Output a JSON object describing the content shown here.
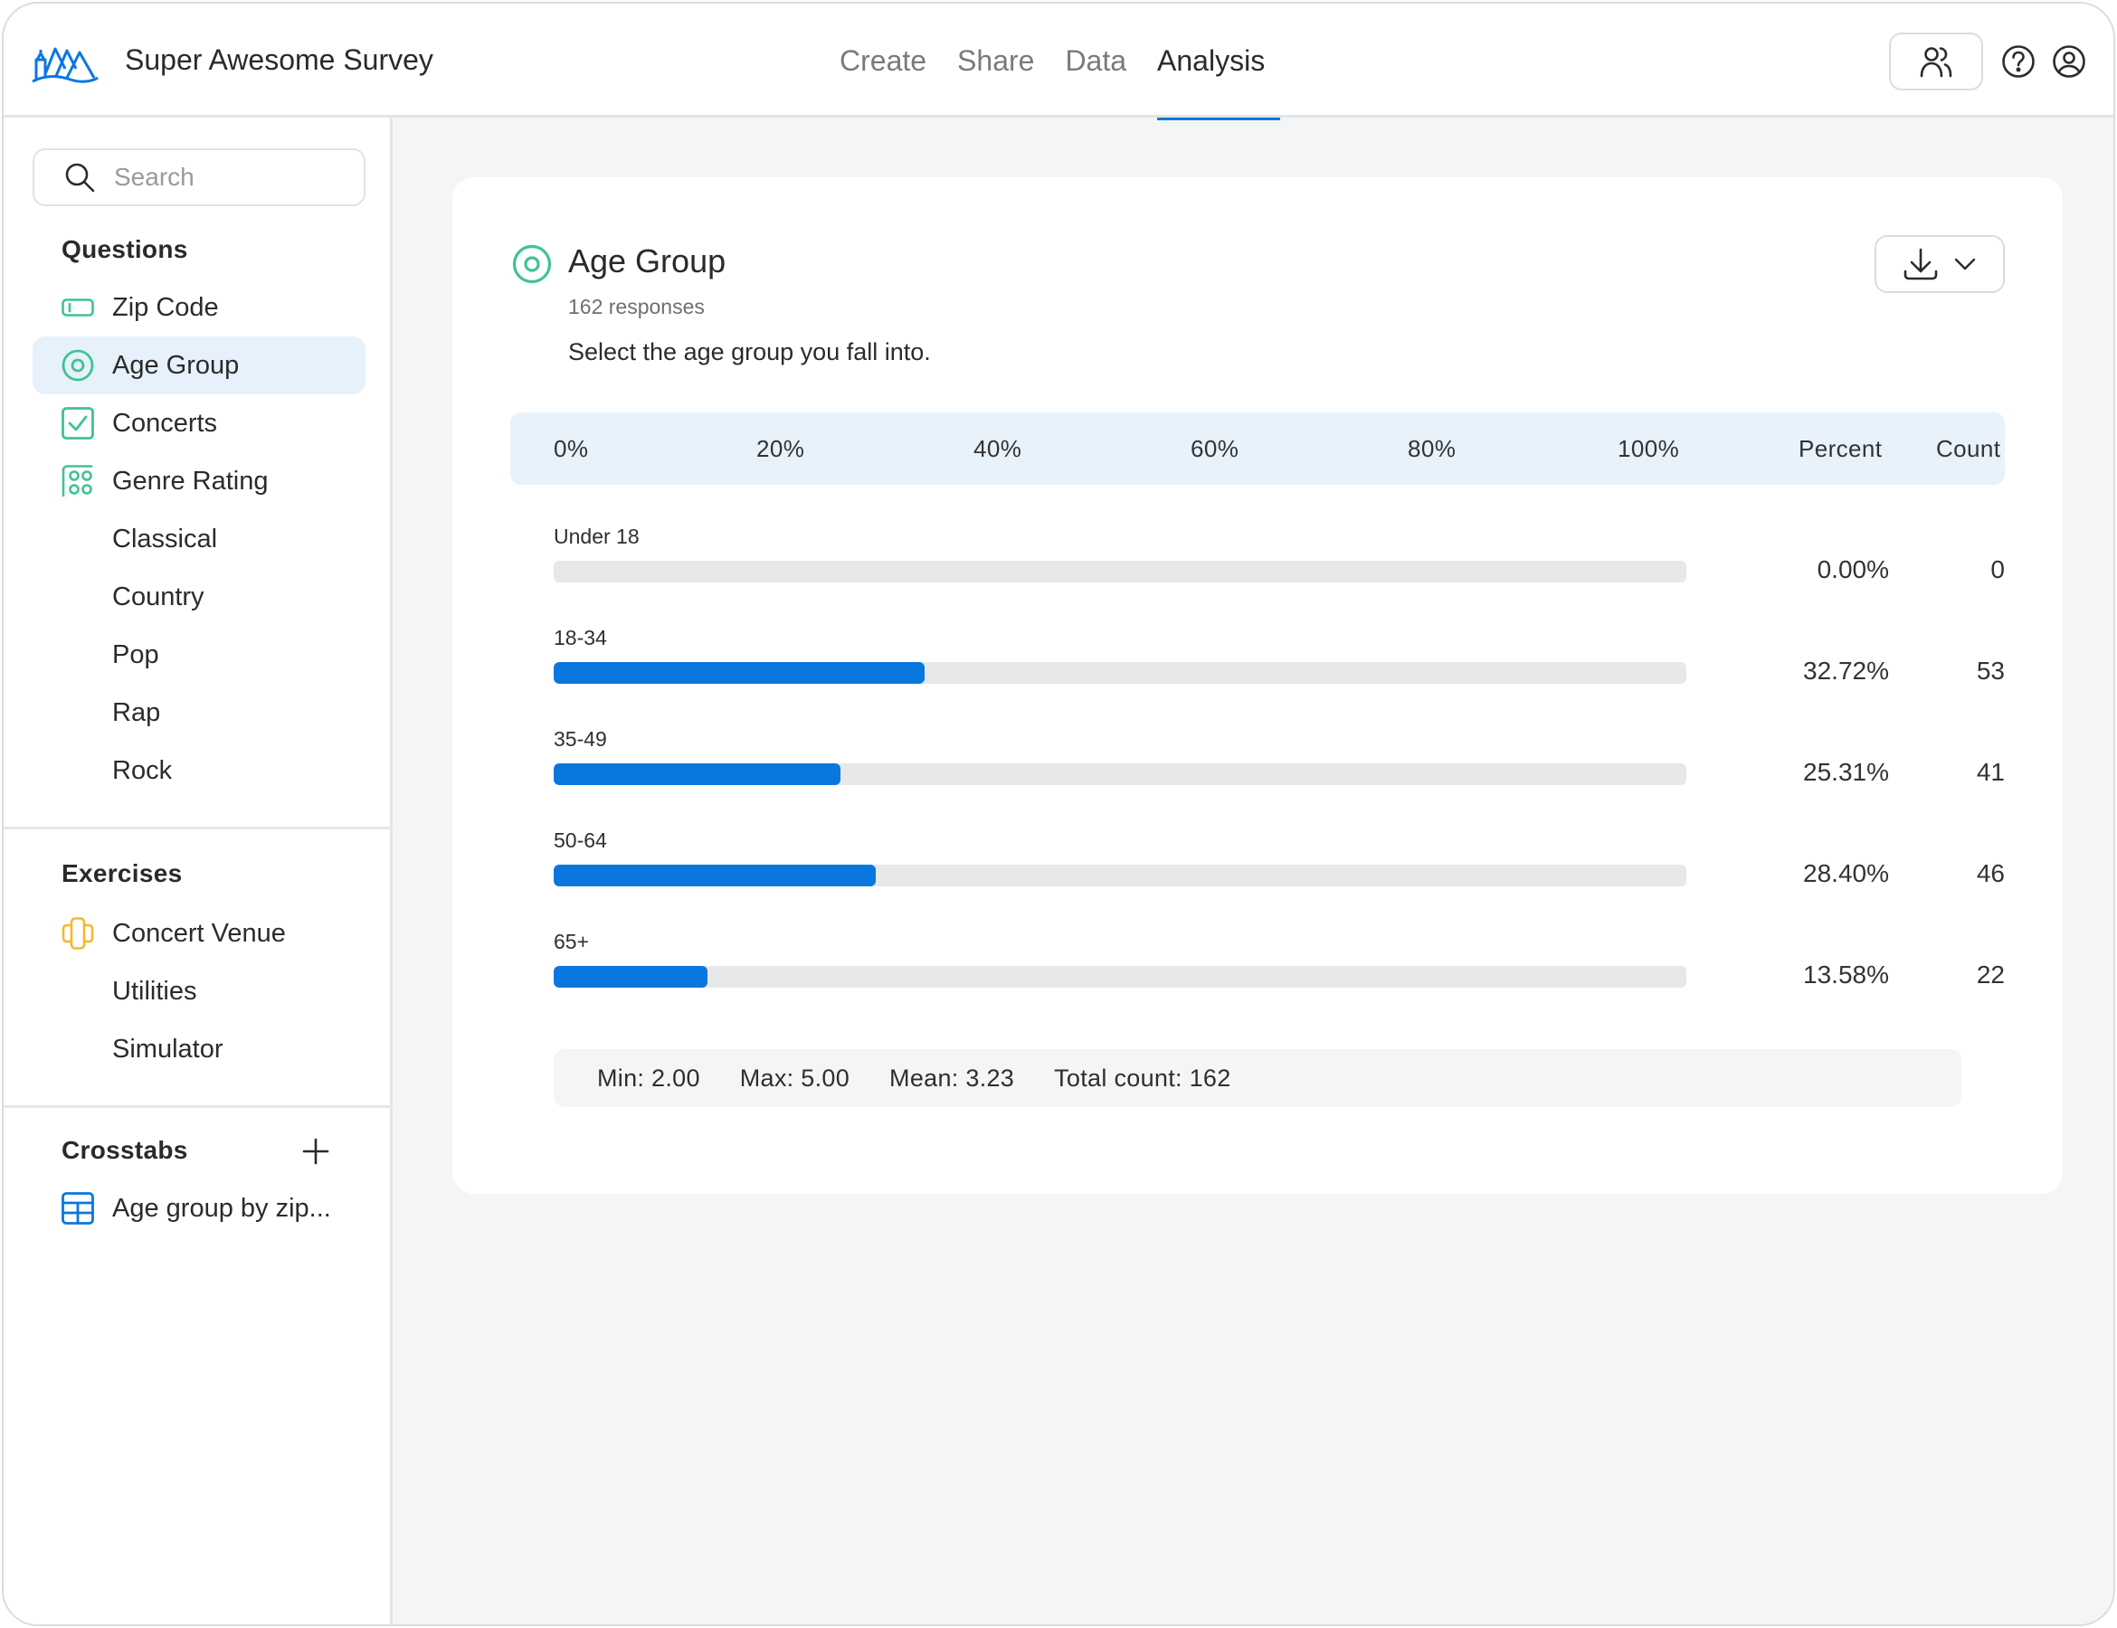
{
  "app": {
    "title": "Super Awesome Survey",
    "brand_color": "#0a77de"
  },
  "nav": {
    "tabs": [
      {
        "label": "Create",
        "active": false
      },
      {
        "label": "Share",
        "active": false
      },
      {
        "label": "Data",
        "active": false
      },
      {
        "label": "Analysis",
        "active": true
      }
    ]
  },
  "header_icons": [
    "collaborators-icon",
    "help-icon",
    "account-icon"
  ],
  "sidebar": {
    "search": {
      "placeholder": "Search",
      "value": ""
    },
    "questions_title": "Questions",
    "questions": [
      {
        "label": "Zip Code",
        "icon": "text-field-icon",
        "active": false
      },
      {
        "label": "Age Group",
        "icon": "radio-icon",
        "active": true
      },
      {
        "label": "Concerts",
        "icon": "checkbox-icon",
        "active": false
      },
      {
        "label": "Genre Rating",
        "icon": "matrix-icon",
        "active": false
      },
      {
        "label": "Classical",
        "sub": true
      },
      {
        "label": "Country",
        "sub": true
      },
      {
        "label": "Pop",
        "sub": true
      },
      {
        "label": "Rap",
        "sub": true
      },
      {
        "label": "Rock",
        "sub": true
      }
    ],
    "exercises_title": "Exercises",
    "exercises": [
      {
        "label": "Concert Venue",
        "icon": "exercise-icon"
      },
      {
        "label": "Utilities",
        "sub": true
      },
      {
        "label": "Simulator",
        "sub": true
      }
    ],
    "crosstabs_title": "Crosstabs",
    "crosstabs": [
      {
        "label": "Age group by zip...",
        "icon": "table-icon"
      }
    ],
    "icon_colors": {
      "question": "#3fc393",
      "exercise": "#f5b82e",
      "crosstab": "#0a77de"
    }
  },
  "question": {
    "title": "Age Group",
    "responses": "162 responses",
    "text": "Select the age group you fall into.",
    "download_icon": "download-icon",
    "stats": {
      "min": "Min: 2.00",
      "max": "Max: 5.00",
      "mean": "Mean: 3.23",
      "total": "Total count: 162"
    }
  },
  "chart_data": {
    "type": "bar",
    "orientation": "horizontal",
    "title": "Age Group",
    "axis_ticks": [
      "0%",
      "20%",
      "40%",
      "60%",
      "80%",
      "100%"
    ],
    "xlim": [
      0,
      100
    ],
    "column_headers": {
      "percent": "Percent",
      "count": "Count"
    },
    "categories": [
      "Under 18",
      "18-34",
      "35-49",
      "50-64",
      "65+"
    ],
    "values": [
      0.0,
      32.72,
      25.31,
      28.4,
      13.58
    ],
    "percent_labels": [
      "0.00%",
      "32.72%",
      "25.31%",
      "28.40%",
      "13.58%"
    ],
    "counts": [
      "0",
      "53",
      "41",
      "46",
      "22"
    ],
    "bar_color": "#0a77de",
    "track_color": "#e7e8ea"
  }
}
